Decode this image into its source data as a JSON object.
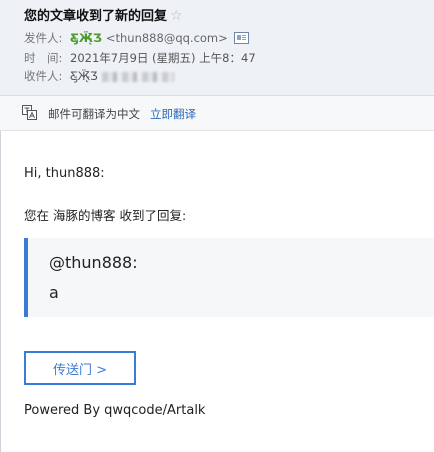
{
  "email": {
    "subject": "您的文章收到了新的回复",
    "star_icon": "☆",
    "from_label": "发件人:",
    "from_name": "Ƹ̵̡Ӝ̵̨̄Ʒ",
    "from_address": "<thun888@qq.com>",
    "time_label": "时　间:",
    "time_value": "2021年7月9日 (星期五) 上午8：47",
    "to_label": "收件人:",
    "to_name": "Ƹ̵̡Ӝ̵̨̄Ʒ"
  },
  "translate_bar": {
    "text": "邮件可翻译为中文",
    "link": "立即翻译"
  },
  "body": {
    "greeting": "Hi, thun888:",
    "info": "您在 海豚的博客 收到了回复:",
    "quote_mention": "@thun888:",
    "quote_content": "a",
    "button": "传送门 >",
    "powered": "Powered By qwqcode/Artalk"
  },
  "colors": {
    "accent": "#3a7bd5",
    "sender_name": "#4a9a2c",
    "link": "#2a69b8"
  }
}
